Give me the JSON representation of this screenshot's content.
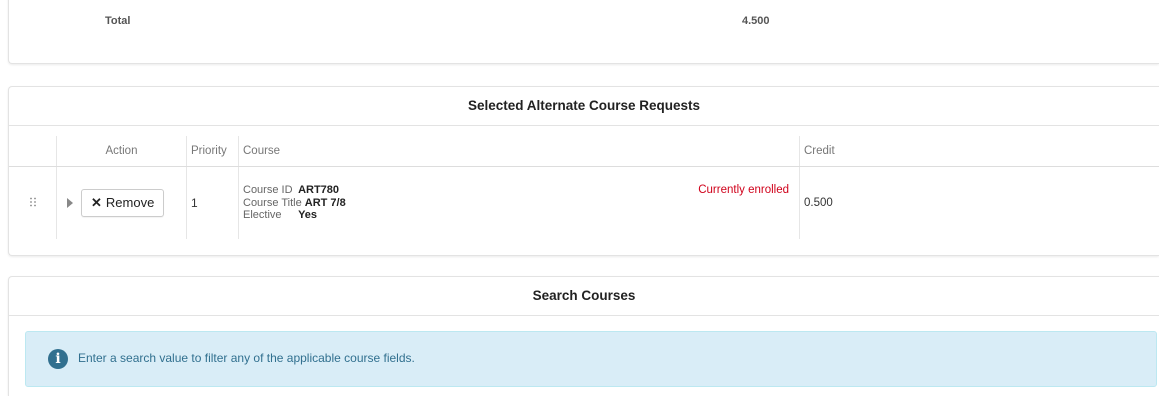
{
  "total": {
    "label": "Total",
    "value": "4.500"
  },
  "alternate": {
    "title": "Selected Alternate Course Requests",
    "columns": {
      "action": "Action",
      "priority": "Priority",
      "course": "Course",
      "credit": "Credit"
    },
    "rows": [
      {
        "handle_icon": "drag-handle-icon",
        "expand_icon": "expand-triangle-icon",
        "remove_icon": "times-icon",
        "remove_label": "Remove",
        "priority": "1",
        "course_id_label": "Course ID",
        "course_id": "ART780",
        "course_title_label": "Course Title",
        "course_title": "ART 7/8",
        "elective_label": "Elective",
        "elective": "Yes",
        "status": "Currently enrolled",
        "credit": "0.500"
      }
    ]
  },
  "search": {
    "title": "Search Courses",
    "info_icon": "info-circle-icon",
    "info_text": "Enter a search value to filter any of the applicable course fields."
  },
  "colors": {
    "status_red": "#d0021b",
    "info_bg": "#d9edf7",
    "info_text": "#31708f"
  }
}
